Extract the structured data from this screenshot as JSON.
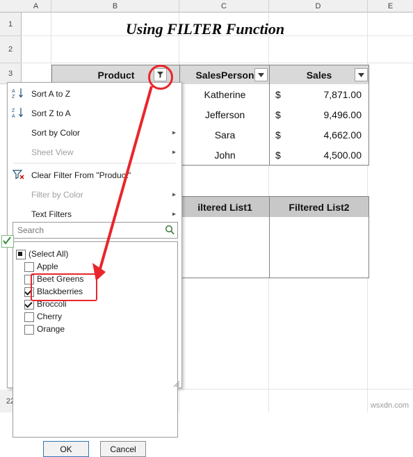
{
  "sheet": {
    "column_headers": [
      "A",
      "B",
      "C",
      "D",
      "E"
    ],
    "row_headers": [
      "1",
      "2",
      "3",
      "22"
    ],
    "title": "Using FILTER Function"
  },
  "data_table": {
    "headers": [
      "Product",
      "SalesPerson",
      "Sales"
    ],
    "rows": [
      {
        "salesperson": "Katherine",
        "currency": "$",
        "amount": "7,871.00"
      },
      {
        "salesperson": "Jefferson",
        "currency": "$",
        "amount": "9,496.00"
      },
      {
        "salesperson": "Sara",
        "currency": "$",
        "amount": "4,662.00"
      },
      {
        "salesperson": "John",
        "currency": "$",
        "amount": "4,500.00"
      }
    ]
  },
  "filtered_table": {
    "headers": [
      "iltered List1",
      "Filtered List2"
    ],
    "rows": [
      "",
      "",
      ""
    ]
  },
  "filter_menu": {
    "items": [
      {
        "label": "Sort A to Z",
        "icon": "sort-az-icon",
        "disabled": false,
        "submenu": false
      },
      {
        "label": "Sort Z to A",
        "icon": "sort-za-icon",
        "disabled": false,
        "submenu": false
      },
      {
        "label": "Sort by Color",
        "icon": "",
        "disabled": false,
        "submenu": true
      },
      {
        "label": "Sheet View",
        "icon": "",
        "disabled": true,
        "submenu": true
      },
      {
        "label": "Clear Filter From \"Product\"",
        "icon": "clear-filter-icon",
        "disabled": false,
        "submenu": false
      },
      {
        "label": "Filter by Color",
        "icon": "",
        "disabled": true,
        "submenu": true
      },
      {
        "label": "Text Filters",
        "icon": "",
        "disabled": false,
        "submenu": true
      }
    ],
    "search": {
      "placeholder": "Search",
      "value": ""
    },
    "checkbox_list": [
      {
        "label": "(Select All)",
        "state": "partial",
        "indent": false
      },
      {
        "label": "Apple",
        "state": "unchecked",
        "indent": true
      },
      {
        "label": "Beet Greens",
        "state": "unchecked",
        "indent": true
      },
      {
        "label": "Blackberries",
        "state": "checked",
        "indent": true
      },
      {
        "label": "Broccoli",
        "state": "checked",
        "indent": true
      },
      {
        "label": "Cherry",
        "state": "unchecked",
        "indent": true
      },
      {
        "label": "Orange",
        "state": "unchecked",
        "indent": true
      }
    ],
    "buttons": {
      "ok": "OK",
      "cancel": "Cancel"
    }
  },
  "watermark": "wsxdn.com",
  "colors": {
    "annotation": "#e8262b",
    "header_fill": "#d9d9d9",
    "header_fill_2": "#c8c8c8"
  }
}
